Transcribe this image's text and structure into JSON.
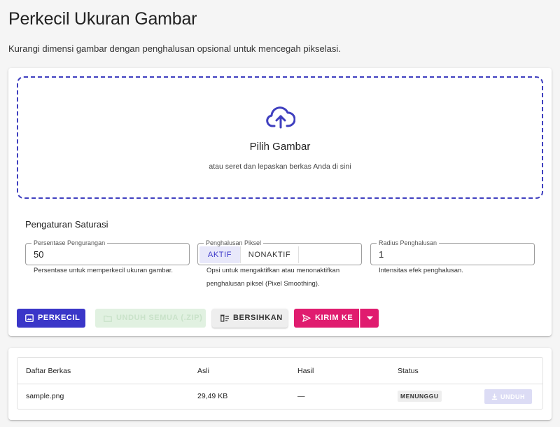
{
  "page": {
    "title": "Perkecil Ukuran Gambar",
    "subtitle": "Kurangi dimensi gambar dengan penghalusan opsional untuk mencegah pikselasi."
  },
  "dropzone": {
    "title": "Pilih Gambar",
    "subtitle": "atau seret dan lepaskan berkas Anda di sini",
    "icon": "cloud-upload-icon",
    "color": "#3f3fbf"
  },
  "settings": {
    "title": "Pengaturan Saturasi",
    "reduction": {
      "label": "Persentase Pengurangan",
      "value": "50",
      "helper": "Persentase untuk memperkecil ukuran gambar."
    },
    "smoothing": {
      "label": "Penghalusan Piksel",
      "options": [
        "AKTIF",
        "NONAKTIF"
      ],
      "selected": "AKTIF",
      "helper": "Opsi untuk mengaktifkan atau menonaktifkan penghalusan piksel (Pixel Smoothing)."
    },
    "radius": {
      "label": "Radius Penghalusan",
      "value": "1",
      "helper": "Intensitas efek penghalusan."
    }
  },
  "actions": {
    "shrink": "PERKECIL",
    "download_all": "UNDUH SEMUA (.ZIP)",
    "clear": "BERSIHKAN",
    "send_to": "KIRIM KE"
  },
  "colors": {
    "primary": "#3a36c8",
    "accent": "#e01c6f"
  },
  "table": {
    "headers": [
      "Daftar Berkas",
      "Asli",
      "Hasil",
      "Status"
    ],
    "rows": [
      {
        "name": "sample.png",
        "original": "29,49 KB",
        "result": "—",
        "status": "MENUNGGU",
        "action": "UNDUH"
      }
    ]
  }
}
